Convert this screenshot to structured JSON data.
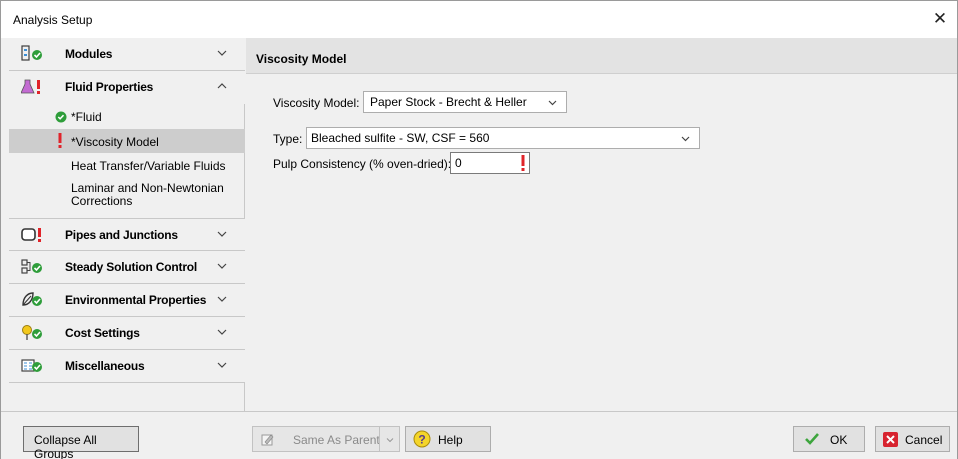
{
  "window": {
    "title": "Analysis Setup",
    "close_glyph": "✕"
  },
  "sidebar": {
    "groups": [
      {
        "label": "Modules",
        "icon": "modules-icon",
        "status": "ok",
        "expanded": false
      },
      {
        "label": "Fluid Properties",
        "icon": "flask-icon",
        "status": "error",
        "expanded": true
      },
      {
        "label": "Pipes and Junctions",
        "icon": "pipe-icon",
        "status": "error",
        "expanded": false
      },
      {
        "label": "Steady Solution Control",
        "icon": "solution-control-icon",
        "status": "ok",
        "expanded": false
      },
      {
        "label": "Environmental Properties",
        "icon": "environment-icon",
        "status": "ok",
        "expanded": false
      },
      {
        "label": "Cost Settings",
        "icon": "cost-icon",
        "status": "ok",
        "expanded": false
      },
      {
        "label": "Miscellaneous",
        "icon": "miscellaneous-icon",
        "status": "ok",
        "expanded": false
      }
    ],
    "fluid_items": [
      {
        "label": "*Fluid",
        "status": "ok"
      },
      {
        "label": "*Viscosity Model",
        "status": "error",
        "selected": true
      },
      {
        "label": "Heat Transfer/Variable Fluids",
        "status": "none"
      },
      {
        "label": "Laminar and Non-Newtonian Corrections",
        "status": "none"
      }
    ]
  },
  "panel": {
    "title": "Viscosity Model",
    "viscosity_model_label": "Viscosity Model:",
    "viscosity_model_value": "Paper Stock - Brecht & Heller",
    "type_label": "Type:",
    "type_value": "Bleached sulfite - SW, CSF = 560",
    "pulp_label": "Pulp Consistency (% oven-dried):",
    "pulp_value": "0"
  },
  "buttons": {
    "collapse_all": "Collapse All Groups",
    "same_as_parent": "Same As Parent",
    "help": "Help",
    "ok": "OK",
    "cancel": "Cancel"
  },
  "colors": {
    "ok_green": "#2e9d3a",
    "error_red": "#e0242a",
    "selected_bg": "#cdcdcd"
  }
}
